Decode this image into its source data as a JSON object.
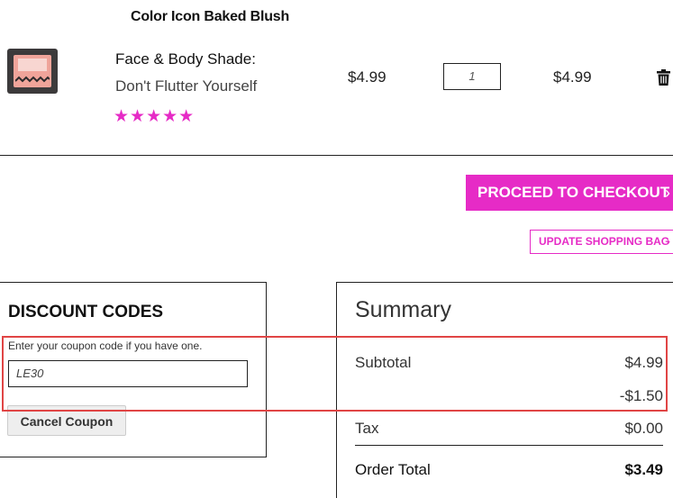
{
  "cart_item": {
    "product_name": "Color Icon Baked Blush",
    "shade_label": "Face & Body Shade:",
    "shade_value": "Don't Flutter Yourself",
    "rating_stars": "★★★★★",
    "price": "$4.99",
    "quantity": "1",
    "line_total": "$4.99",
    "remove_icon": "trash-icon"
  },
  "actions": {
    "checkout_label": "PROCEED TO CHECKOUT",
    "update_label": "UPDATE SHOPPING BAG",
    "chevron": "›",
    "accent_color": "#e62bc6"
  },
  "discount": {
    "title": "DISCOUNT CODES",
    "hint": "Enter your coupon code if you have one.",
    "code_value": "LE30",
    "cancel_label": "Cancel Coupon"
  },
  "summary": {
    "title": "Summary",
    "subtotal_label": "Subtotal",
    "subtotal_value": "$4.99",
    "discount_value": "-$1.50",
    "tax_label": "Tax",
    "tax_value": "$0.00",
    "total_label": "Order Total",
    "total_value": "$3.49"
  },
  "highlight_color": "#e04545"
}
